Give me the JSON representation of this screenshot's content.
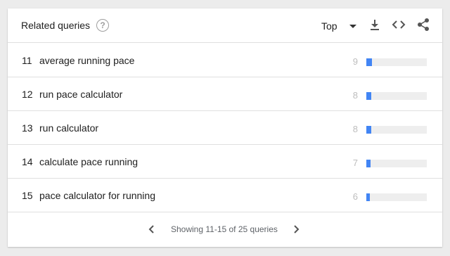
{
  "header": {
    "title": "Related queries",
    "help_icon": "help-circle-icon",
    "select_value": "Top",
    "tools": [
      "download-icon",
      "embed-code-icon",
      "share-icon"
    ]
  },
  "rows": [
    {
      "rank": "11",
      "query": "average running pace",
      "value": "9",
      "bar_fraction": 0.09
    },
    {
      "rank": "12",
      "query": "run pace calculator",
      "value": "8",
      "bar_fraction": 0.08
    },
    {
      "rank": "13",
      "query": "run calculator",
      "value": "8",
      "bar_fraction": 0.08
    },
    {
      "rank": "14",
      "query": "calculate pace running",
      "value": "7",
      "bar_fraction": 0.07
    },
    {
      "rank": "15",
      "query": "pace calculator for running",
      "value": "6",
      "bar_fraction": 0.06
    }
  ],
  "footer": {
    "pager_text": "Showing 11-15 of 25 queries"
  },
  "colors": {
    "bar": "#4285f4",
    "track": "#eeeeee"
  }
}
